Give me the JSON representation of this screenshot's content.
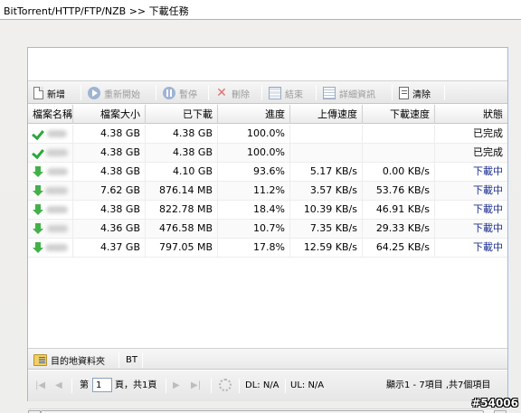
{
  "window": {
    "breadcrumb": "BitTorrent/HTTP/FTP/NZB >> 下載任務"
  },
  "toolbar": {
    "new_label": "新增",
    "resume_label": "重新開始",
    "pause_label": "暫停",
    "delete_label": "刪除",
    "end_label": "結束",
    "details_label": "詳細資訊",
    "clear_label": "清除"
  },
  "columns": {
    "name": "檔案名稱",
    "size": "檔案大小",
    "downloaded": "已下載",
    "progress": "進度",
    "upload_speed": "上傳速度",
    "download_speed": "下載速度",
    "status": "狀態"
  },
  "rows": [
    {
      "icon": "check-icon",
      "size": "4.38 GB",
      "downloaded": "4.38 GB",
      "progress": "100.0%",
      "upload_speed": "",
      "download_speed": "",
      "status": "已完成",
      "state": "done"
    },
    {
      "icon": "check-icon",
      "size": "4.38 GB",
      "downloaded": "4.38 GB",
      "progress": "100.0%",
      "upload_speed": "",
      "download_speed": "",
      "status": "已完成",
      "state": "done"
    },
    {
      "icon": "download-arrow-icon",
      "size": "4.38 GB",
      "downloaded": "4.10 GB",
      "progress": "93.6%",
      "upload_speed": "5.17 KB/s",
      "download_speed": "0.00 KB/s",
      "status": "下載中",
      "state": "downloading"
    },
    {
      "icon": "download-arrow-icon",
      "size": "7.62 GB",
      "downloaded": "876.14 MB",
      "progress": "11.2%",
      "upload_speed": "3.57 KB/s",
      "download_speed": "53.76 KB/s",
      "status": "下載中",
      "state": "downloading"
    },
    {
      "icon": "download-arrow-icon",
      "size": "4.38 GB",
      "downloaded": "822.78 MB",
      "progress": "18.4%",
      "upload_speed": "10.39 KB/s",
      "download_speed": "46.91 KB/s",
      "status": "下載中",
      "state": "downloading"
    },
    {
      "icon": "download-arrow-icon",
      "size": "4.36 GB",
      "downloaded": "476.58 MB",
      "progress": "10.7%",
      "upload_speed": "7.35 KB/s",
      "download_speed": "29.33 KB/s",
      "status": "下載中",
      "state": "downloading"
    },
    {
      "icon": "download-arrow-icon",
      "size": "4.37 GB",
      "downloaded": "797.05 MB",
      "progress": "17.8%",
      "upload_speed": "12.59 KB/s",
      "download_speed": "64.25 KB/s",
      "status": "下載中",
      "state": "downloading"
    }
  ],
  "tabs": {
    "destination_label": "目的地資料夾",
    "bt_label": "BT"
  },
  "pager": {
    "page_prefix": "第",
    "page_value": "1",
    "page_suffix": "頁，共1頁",
    "dl": "DL: N/A",
    "ul": "UL: N/A",
    "summary": "顯示1 - 7項目 ,共7個項目"
  },
  "watermark": "#54006",
  "colors": {
    "status_downloading": "#1c2f8f",
    "panel_border": "#99bbe8",
    "check_green": "#2aa83a"
  }
}
